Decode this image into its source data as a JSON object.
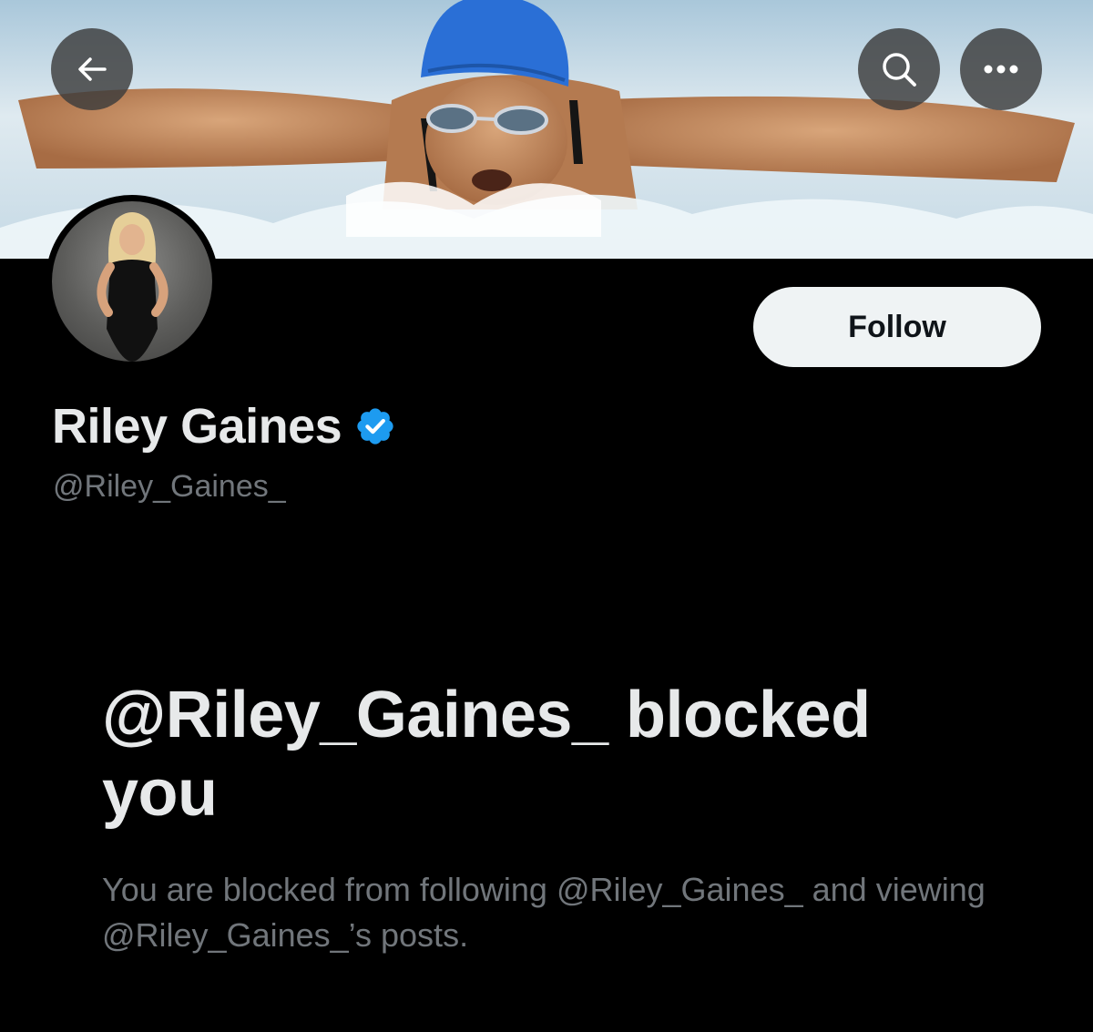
{
  "header": {
    "back_icon": "arrow-left-icon",
    "search_icon": "search-icon",
    "more_icon": "more-horizontal-icon"
  },
  "profile": {
    "name": "Riley Gaines",
    "verified_icon": "verified-badge-icon",
    "handle": "@Riley_Gaines_",
    "follow_label": "Follow"
  },
  "blocked": {
    "title": "@Riley_Gaines_ blocked you",
    "message": "You are blocked from following @Riley_Gaines_ and viewing @Riley_Gaines_’s posts."
  },
  "colors": {
    "background": "#000000",
    "primary_text": "#e7e9ea",
    "secondary_text": "#71767b",
    "verified_blue": "#1d9bf0",
    "follow_bg": "#eff3f4"
  }
}
